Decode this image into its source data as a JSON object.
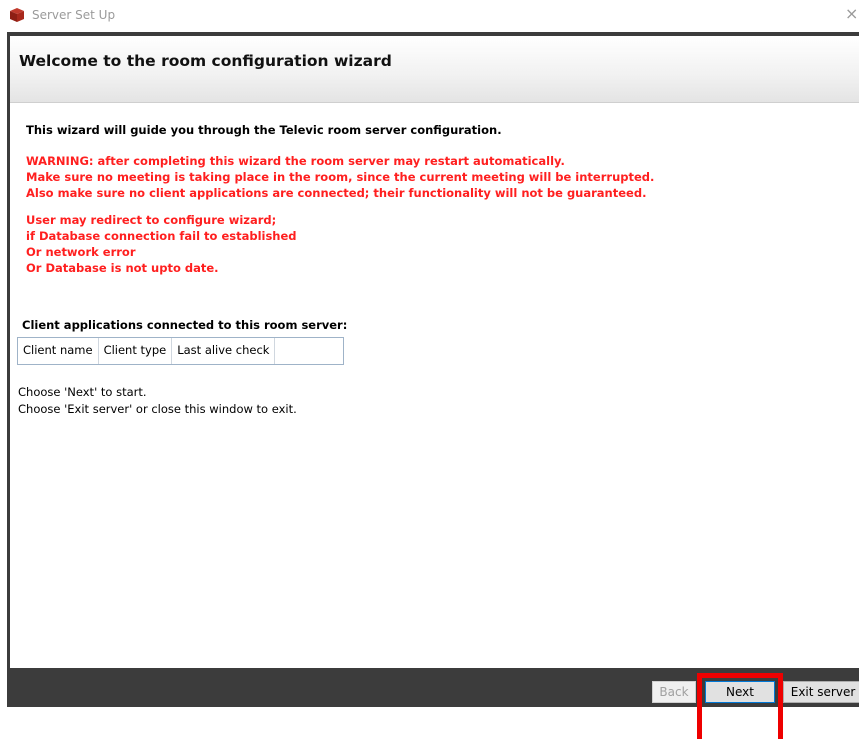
{
  "window": {
    "title": "Server Set Up",
    "close_glyph": "×",
    "app_icon": "red-cube-icon"
  },
  "wizard": {
    "heading": "Welcome to the room configuration wizard",
    "intro": "This wizard will guide you through the Televic room server configuration.",
    "warnings": [
      "WARNING: after completing this wizard the room server may restart automatically.",
      "Make sure no meeting is taking place in the room, since the current meeting will be interrupted.",
      "Also make sure no client applications are connected; their functionality will not be guaranteed."
    ],
    "redirect_notes": [
      "User may redirect to configure wizard;",
      "if Database connection fail to established",
      "Or network error",
      "Or Database is not upto date."
    ],
    "clients_title": "Client applications connected to this room server:",
    "client_columns": [
      "Client name",
      "Client type",
      "Last alive check"
    ],
    "hint_next": "Choose 'Next' to start.",
    "hint_exit": "Choose 'Exit server' or close this window to exit."
  },
  "buttons": {
    "back": "Back",
    "next": "Next",
    "exit": "Exit server"
  },
  "colors": {
    "warning_red": "#ff1f1f",
    "frame_dark": "#3c3c3c",
    "highlight_red": "#ee0000"
  }
}
